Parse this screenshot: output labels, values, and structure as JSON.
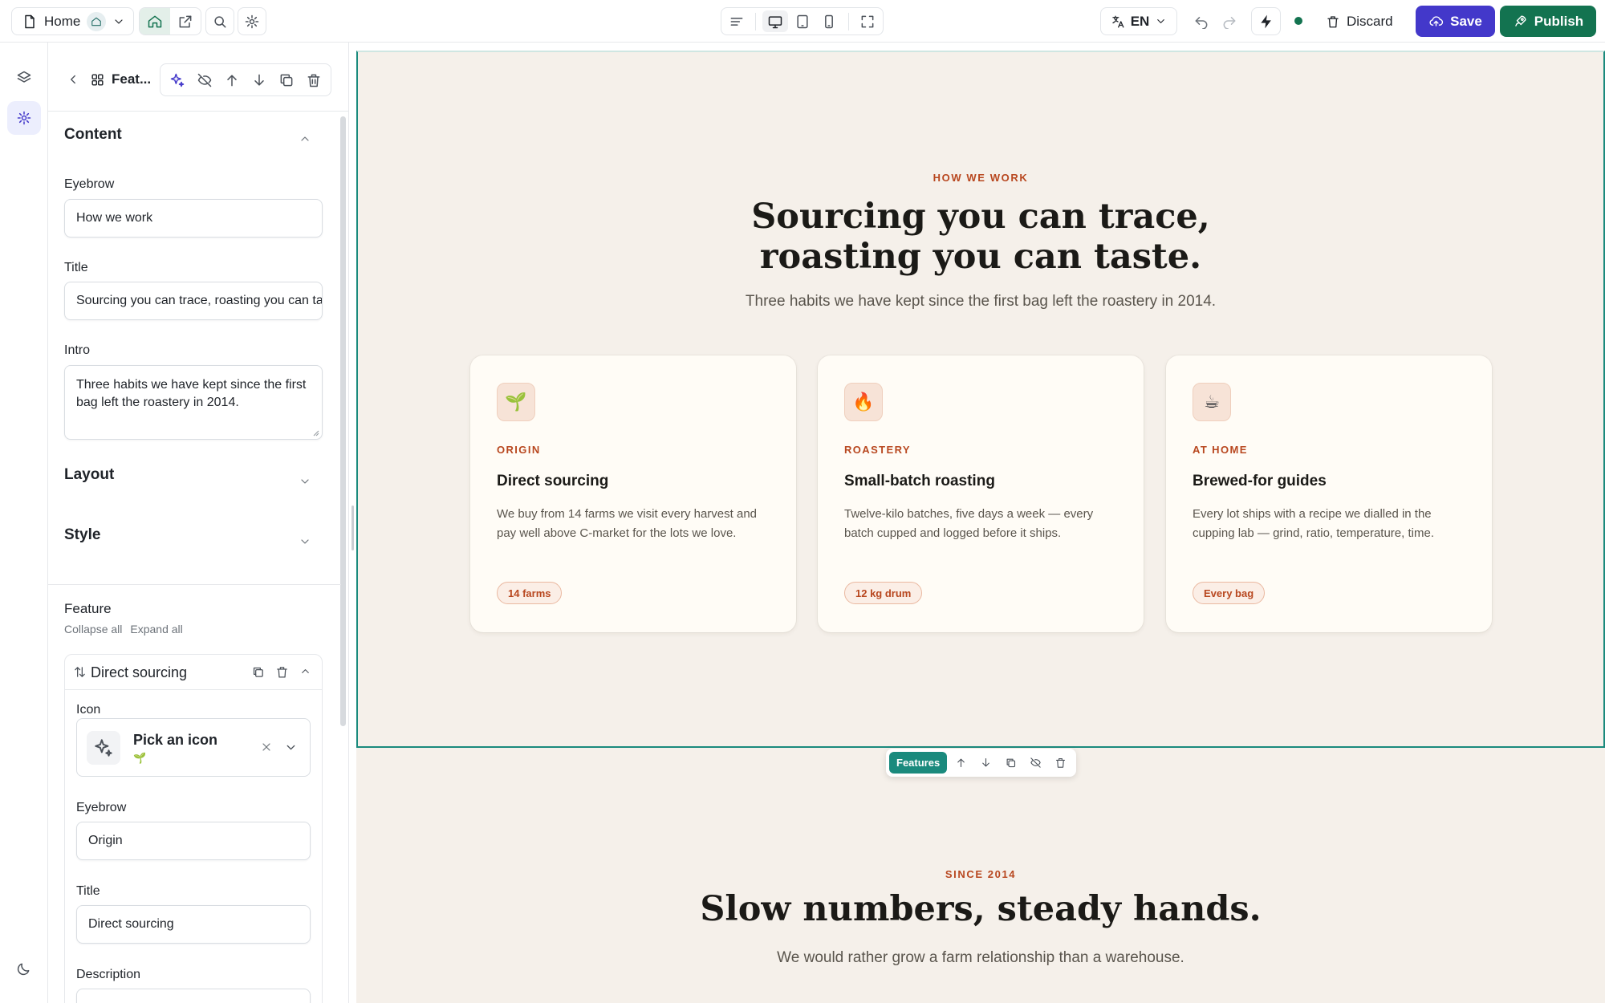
{
  "topbar": {
    "page_name": "Home",
    "language": "EN",
    "discard_label": "Discard",
    "save_label": "Save",
    "publish_label": "Publish"
  },
  "panel": {
    "breadcrumb_label": "Feat...",
    "sections": {
      "content": "Content",
      "layout": "Layout",
      "style": "Style"
    },
    "fields": {
      "eyebrow_label": "Eyebrow",
      "eyebrow_value": "How we work",
      "title_label": "Title",
      "title_value": "Sourcing you can trace, roasting you can taste.",
      "intro_label": "Intro",
      "intro_value": "Three habits we have kept since the first bag left the roastery in 2014."
    },
    "repeater": {
      "label": "Feature",
      "collapse_all": "Collapse all",
      "expand_all": "Expand all",
      "item": {
        "name": "Direct sourcing",
        "icon_label": "Icon",
        "icon_placeholder": "Pick an icon",
        "icon_value": "🌱",
        "eyebrow_label": "Eyebrow",
        "eyebrow_value": "Origin",
        "title_label": "Title",
        "title_value": "Direct sourcing",
        "description_label": "Description"
      }
    }
  },
  "canvas": {
    "features": {
      "eyebrow": "HOW WE WORK",
      "title_line1": "Sourcing you can trace,",
      "title_line2": "roasting you can taste.",
      "intro": "Three habits we have kept since the first bag left the roastery in 2014.",
      "cards": [
        {
          "icon": "🌱",
          "eyebrow": "ORIGIN",
          "title": "Direct sourcing",
          "description": "We buy from 14 farms we visit every harvest and pay well above C-market for the lots we love.",
          "tag": "14 farms"
        },
        {
          "icon": "🔥",
          "eyebrow": "ROASTERY",
          "title": "Small-batch roasting",
          "description": "Twelve-kilo batches, five days a week — every batch cupped and logged before it ships.",
          "tag": "12 kg drum"
        },
        {
          "icon": "☕",
          "eyebrow": "AT HOME",
          "title": "Brewed-for guides",
          "description": "Every lot ships with a recipe we dialled in the cupping lab — grind, ratio, temperature, time.",
          "tag": "Every bag"
        }
      ]
    },
    "section_toolbar_label": "Features",
    "stats": {
      "eyebrow": "SINCE 2014",
      "title": "Slow numbers, steady hands.",
      "intro": "We would rather grow a farm relationship than a warehouse."
    }
  },
  "colors": {
    "save": "#4338ca",
    "publish": "#137350",
    "accent_text": "#b8471f",
    "selection": "#1a8a7d",
    "canvas_bg": "#f5f0ea"
  }
}
